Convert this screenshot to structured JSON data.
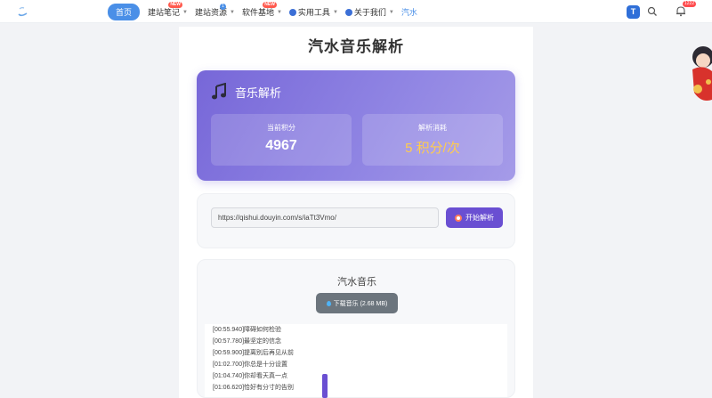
{
  "nav": {
    "items": [
      {
        "label": "首页",
        "active": true
      },
      {
        "label": "建站笔记",
        "badge": "NEW"
      },
      {
        "label": "建站资源",
        "dot": "1"
      },
      {
        "label": "软件基地",
        "badge": "NEW"
      },
      {
        "label": "实用工具"
      },
      {
        "label": "关于我们"
      },
      {
        "label": "汽水"
      }
    ],
    "app_icon": "T",
    "search_icon": "search-icon",
    "bell_badge": "1222"
  },
  "page": {
    "title": "汽水音乐解析"
  },
  "hero": {
    "title": "音乐解析",
    "icon": "music-note-icon",
    "points_label": "当前积分",
    "points_value": "4967",
    "cost_label": "解析消耗",
    "cost_value": "5 积分/次"
  },
  "form": {
    "url_value": "https://qishui.douyin.com/s/iaTt3Vmo/",
    "parse_label": "开始解析"
  },
  "result": {
    "song_title": "汽水音乐",
    "download_label": "下载音乐 (2.68 MB)",
    "lyrics": [
      "[00:55.940]障碍如何检验",
      "[00:57.780]最坚定的信念",
      "[00:59.900]提离别后再见从前",
      "[01:02.700]你总是十分设置",
      "[01:04.740]你却看天真一点",
      "[01:06.620]恰好有分寸的告别"
    ]
  },
  "colors": {
    "accent": "#6a4fd2",
    "nav_active": "#4a8fe7",
    "gold": "#ffcc4d",
    "download_btn": "#6c757d"
  }
}
